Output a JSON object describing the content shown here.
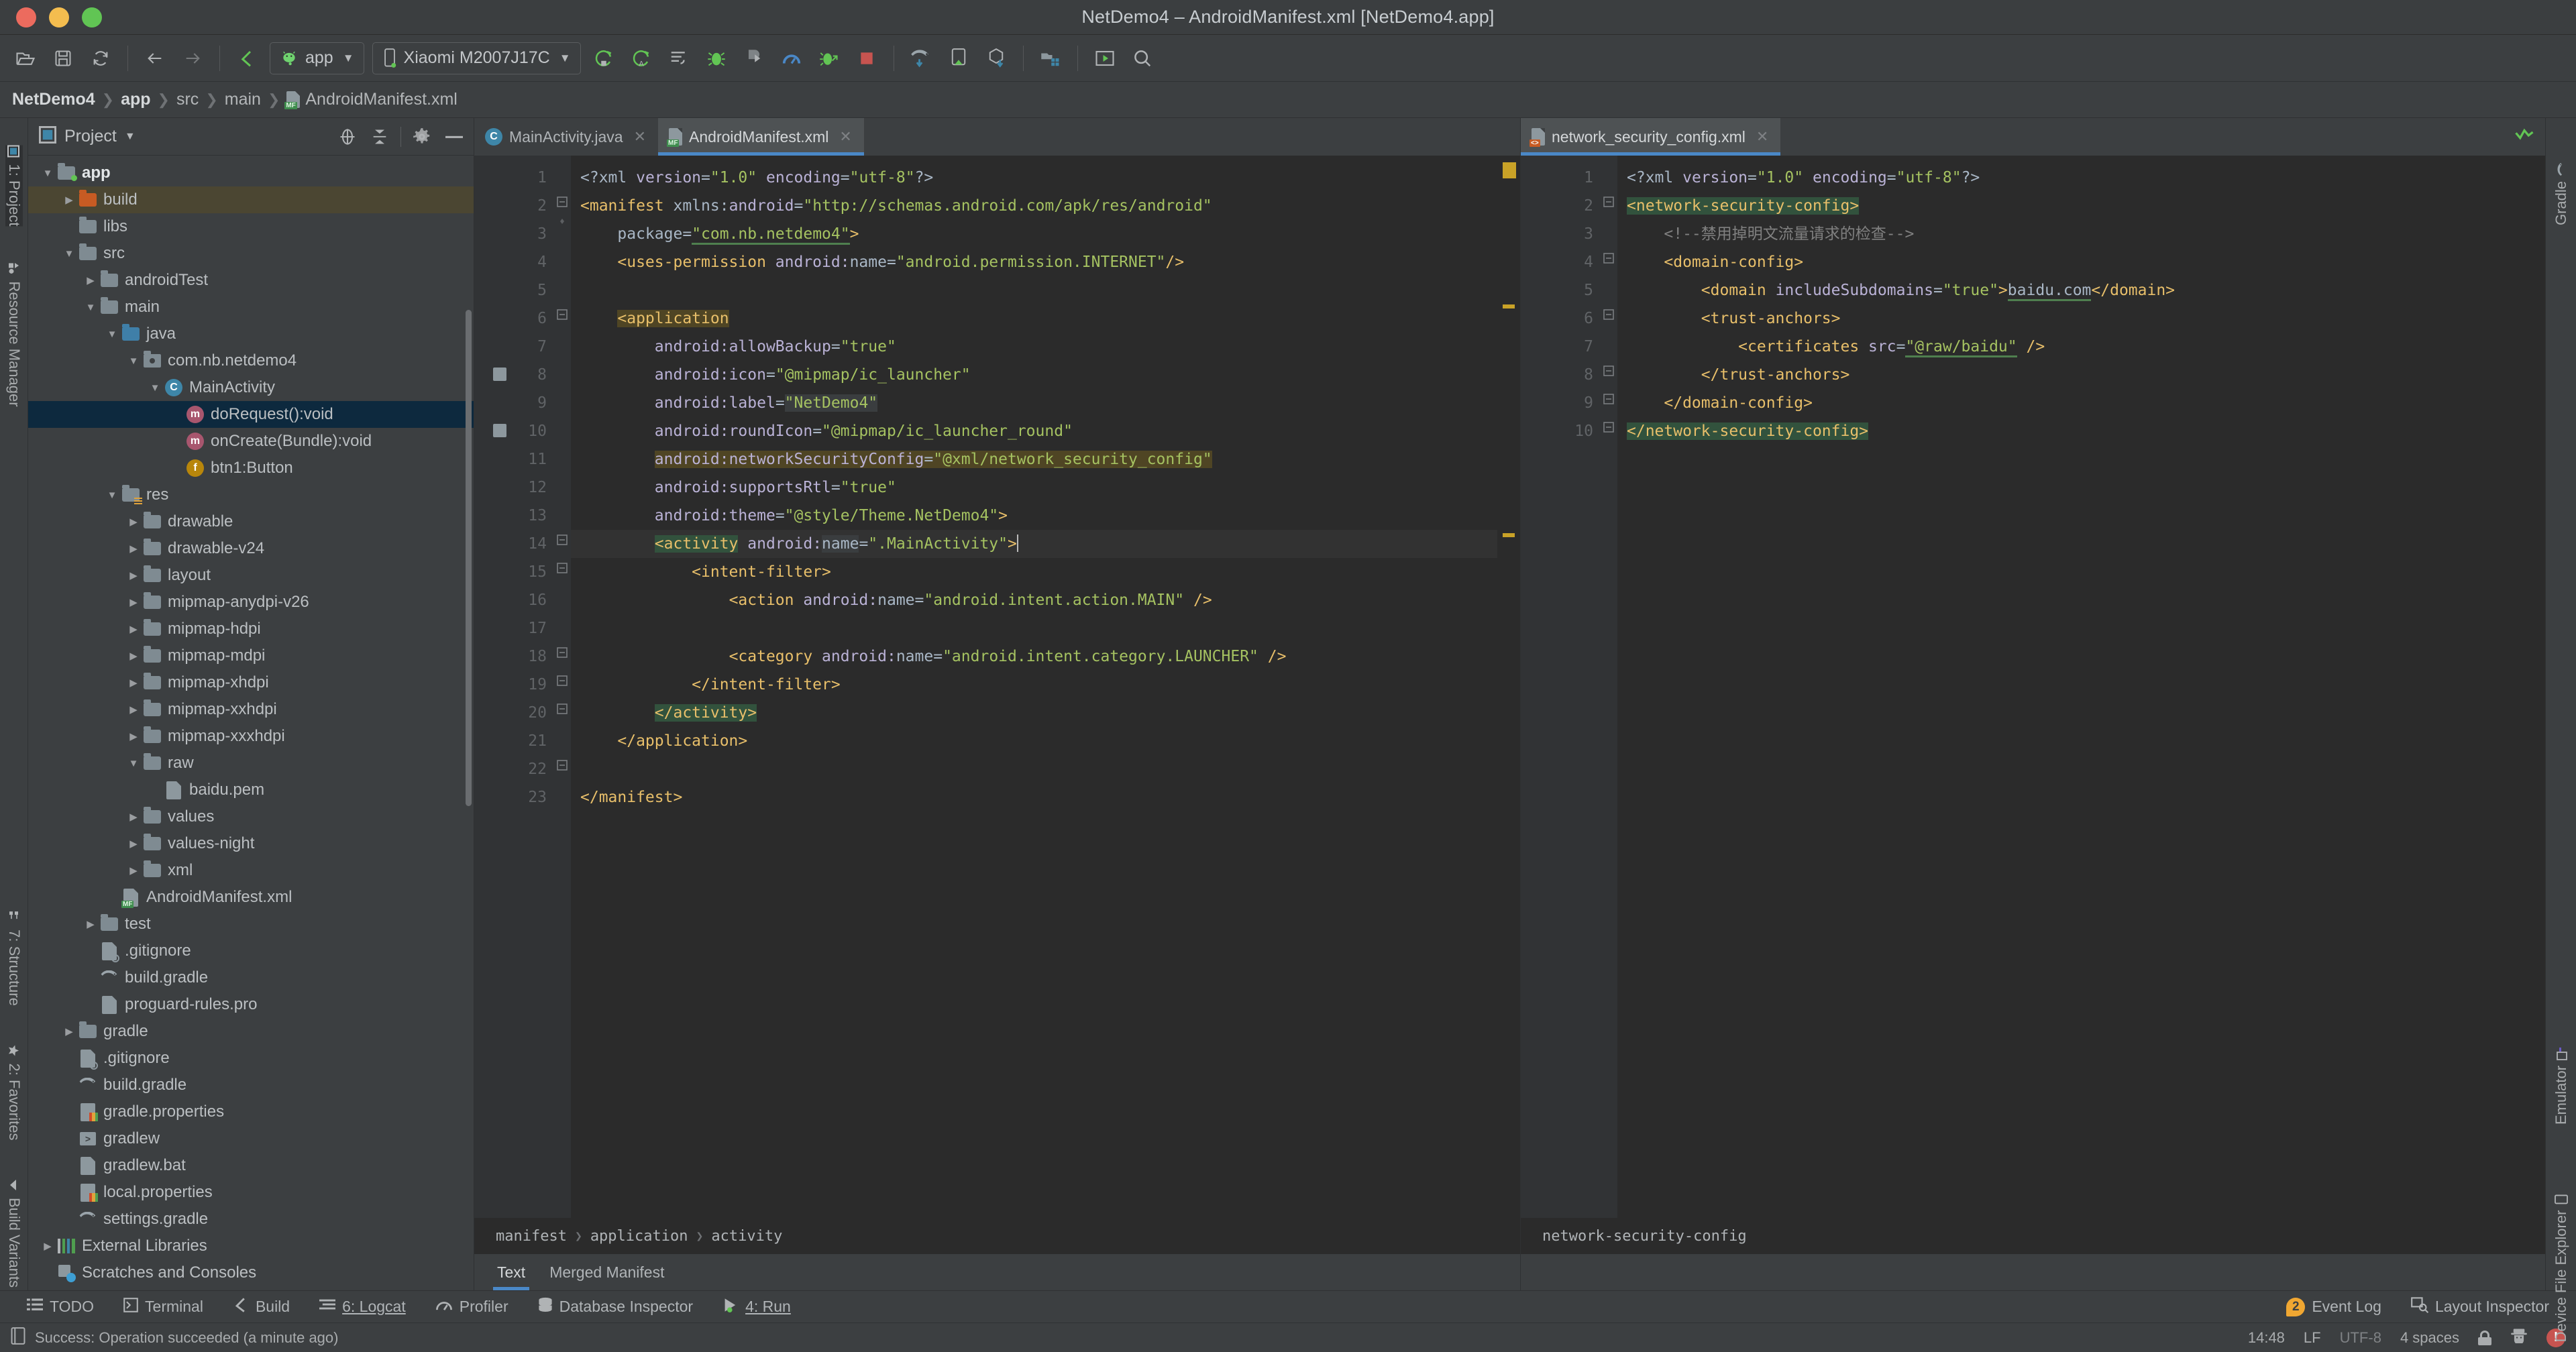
{
  "window": {
    "title": "NetDemo4 – AndroidManifest.xml [NetDemo4.app]"
  },
  "toolbar": {
    "module_combo": "app",
    "device_combo": "Xiaomi M2007J17C"
  },
  "navbar": {
    "items": [
      "NetDemo4",
      "app",
      "src",
      "main",
      "AndroidManifest.xml"
    ]
  },
  "left_strip": {
    "items": [
      "1: Project",
      "Resource Manager",
      "7: Structure",
      "2: Favorites",
      "Build Variants"
    ]
  },
  "right_strip": {
    "items": [
      "Gradle",
      "Emulator",
      "Device File Explorer"
    ]
  },
  "project_pane": {
    "title": "Project",
    "tree": [
      {
        "label": "app",
        "indent": 1,
        "arrow": "down",
        "icon": "folder-module",
        "bold": true,
        "sel": ""
      },
      {
        "label": "build",
        "indent": 2,
        "arrow": "right",
        "icon": "folder-orange",
        "bold": false,
        "sel": "build"
      },
      {
        "label": "libs",
        "indent": 2,
        "arrow": "none",
        "icon": "folder",
        "bold": false,
        "sel": ""
      },
      {
        "label": "src",
        "indent": 2,
        "arrow": "down",
        "icon": "folder",
        "bold": false,
        "sel": ""
      },
      {
        "label": "androidTest",
        "indent": 3,
        "arrow": "right",
        "icon": "folder",
        "bold": false,
        "sel": ""
      },
      {
        "label": "main",
        "indent": 3,
        "arrow": "down",
        "icon": "folder",
        "bold": false,
        "sel": ""
      },
      {
        "label": "java",
        "indent": 4,
        "arrow": "down",
        "icon": "folder-blue",
        "bold": false,
        "sel": ""
      },
      {
        "label": "com.nb.netdemo4",
        "indent": 5,
        "arrow": "down",
        "icon": "package",
        "bold": false,
        "sel": ""
      },
      {
        "label": "MainActivity",
        "indent": 6,
        "arrow": "down",
        "icon": "class",
        "bold": false,
        "sel": ""
      },
      {
        "label": "doRequest():void",
        "indent": 7,
        "arrow": "none",
        "icon": "method",
        "bold": false,
        "sel": "blue"
      },
      {
        "label": "onCreate(Bundle):void",
        "indent": 7,
        "arrow": "none",
        "icon": "method",
        "bold": false,
        "sel": ""
      },
      {
        "label": "btn1:Button",
        "indent": 7,
        "arrow": "none",
        "icon": "field",
        "bold": false,
        "sel": ""
      },
      {
        "label": "res",
        "indent": 4,
        "arrow": "down",
        "icon": "folder-res",
        "bold": false,
        "sel": ""
      },
      {
        "label": "drawable",
        "indent": 5,
        "arrow": "right",
        "icon": "folder",
        "bold": false,
        "sel": ""
      },
      {
        "label": "drawable-v24",
        "indent": 5,
        "arrow": "right",
        "icon": "folder",
        "bold": false,
        "sel": ""
      },
      {
        "label": "layout",
        "indent": 5,
        "arrow": "right",
        "icon": "folder",
        "bold": false,
        "sel": ""
      },
      {
        "label": "mipmap-anydpi-v26",
        "indent": 5,
        "arrow": "right",
        "icon": "folder",
        "bold": false,
        "sel": ""
      },
      {
        "label": "mipmap-hdpi",
        "indent": 5,
        "arrow": "right",
        "icon": "folder",
        "bold": false,
        "sel": ""
      },
      {
        "label": "mipmap-mdpi",
        "indent": 5,
        "arrow": "right",
        "icon": "folder",
        "bold": false,
        "sel": ""
      },
      {
        "label": "mipmap-xhdpi",
        "indent": 5,
        "arrow": "right",
        "icon": "folder",
        "bold": false,
        "sel": ""
      },
      {
        "label": "mipmap-xxhdpi",
        "indent": 5,
        "arrow": "right",
        "icon": "folder",
        "bold": false,
        "sel": ""
      },
      {
        "label": "mipmap-xxxhdpi",
        "indent": 5,
        "arrow": "right",
        "icon": "folder",
        "bold": false,
        "sel": ""
      },
      {
        "label": "raw",
        "indent": 5,
        "arrow": "down",
        "icon": "folder",
        "bold": false,
        "sel": ""
      },
      {
        "label": "baidu.pem",
        "indent": 6,
        "arrow": "none",
        "icon": "file-text",
        "bold": false,
        "sel": ""
      },
      {
        "label": "values",
        "indent": 5,
        "arrow": "right",
        "icon": "folder",
        "bold": false,
        "sel": ""
      },
      {
        "label": "values-night",
        "indent": 5,
        "arrow": "right",
        "icon": "folder",
        "bold": false,
        "sel": ""
      },
      {
        "label": "xml",
        "indent": 5,
        "arrow": "right",
        "icon": "folder",
        "bold": false,
        "sel": ""
      },
      {
        "label": "AndroidManifest.xml",
        "indent": 4,
        "arrow": "none",
        "icon": "file-manifest",
        "bold": false,
        "sel": ""
      },
      {
        "label": "test",
        "indent": 3,
        "arrow": "right",
        "icon": "folder",
        "bold": false,
        "sel": ""
      },
      {
        "label": ".gitignore",
        "indent": 3,
        "arrow": "none",
        "icon": "file-git",
        "bold": false,
        "sel": ""
      },
      {
        "label": "build.gradle",
        "indent": 3,
        "arrow": "none",
        "icon": "gradle",
        "bold": false,
        "sel": ""
      },
      {
        "label": "proguard-rules.pro",
        "indent": 3,
        "arrow": "none",
        "icon": "file-text",
        "bold": false,
        "sel": ""
      },
      {
        "label": "gradle",
        "indent": 2,
        "arrow": "right",
        "icon": "folder",
        "bold": false,
        "sel": ""
      },
      {
        "label": ".gitignore",
        "indent": 2,
        "arrow": "none",
        "icon": "file-git",
        "bold": false,
        "sel": ""
      },
      {
        "label": "build.gradle",
        "indent": 2,
        "arrow": "none",
        "icon": "gradle",
        "bold": false,
        "sel": ""
      },
      {
        "label": "gradle.properties",
        "indent": 2,
        "arrow": "none",
        "icon": "file-props",
        "bold": false,
        "sel": ""
      },
      {
        "label": "gradlew",
        "indent": 2,
        "arrow": "none",
        "icon": "file-shell",
        "bold": false,
        "sel": ""
      },
      {
        "label": "gradlew.bat",
        "indent": 2,
        "arrow": "none",
        "icon": "file-text",
        "bold": false,
        "sel": ""
      },
      {
        "label": "local.properties",
        "indent": 2,
        "arrow": "none",
        "icon": "file-props",
        "bold": false,
        "sel": ""
      },
      {
        "label": "settings.gradle",
        "indent": 2,
        "arrow": "none",
        "icon": "gradle",
        "bold": false,
        "sel": ""
      },
      {
        "label": "External Libraries",
        "indent": 1,
        "arrow": "right",
        "icon": "libraries",
        "bold": false,
        "sel": ""
      },
      {
        "label": "Scratches and Consoles",
        "indent": 1,
        "arrow": "none",
        "icon": "scratches",
        "bold": false,
        "sel": ""
      }
    ]
  },
  "editor_left": {
    "tabs": [
      {
        "label": "MainActivity.java",
        "icon": "java-class-icon",
        "active": false
      },
      {
        "label": "AndroidManifest.xml",
        "icon": "manifest-icon",
        "active": true
      }
    ],
    "breadcrumb": [
      "manifest",
      "application",
      "activity"
    ],
    "bottom_tabs": [
      {
        "label": "Text",
        "active": true
      },
      {
        "label": "Merged Manifest",
        "active": false
      }
    ],
    "line_numbers": [
      1,
      2,
      3,
      4,
      5,
      6,
      7,
      8,
      9,
      10,
      11,
      12,
      13,
      14,
      15,
      16,
      17,
      18,
      19,
      20,
      21,
      22,
      23
    ]
  },
  "editor_right": {
    "tabs": [
      {
        "label": "network_security_config.xml",
        "icon": "xml-icon",
        "active": true
      }
    ],
    "breadcrumb": [
      "network-security-config"
    ],
    "line_numbers": [
      1,
      2,
      3,
      4,
      5,
      6,
      7,
      8,
      9,
      10
    ]
  },
  "tool_windows": [
    {
      "label": "TODO",
      "icon": "todo-icon"
    },
    {
      "label": "Terminal",
      "icon": "terminal-icon"
    },
    {
      "label": "Build",
      "icon": "build-icon"
    },
    {
      "label": "6: Logcat",
      "icon": "logcat-icon"
    },
    {
      "label": "Profiler",
      "icon": "profiler-icon"
    },
    {
      "label": "Database Inspector",
      "icon": "database-icon"
    },
    {
      "label": "4: Run",
      "icon": "run-icon"
    }
  ],
  "tool_windows_right": [
    {
      "label": "Event Log",
      "icon": "event-log-icon",
      "badge": "2"
    },
    {
      "label": "Layout Inspector",
      "icon": "layout-inspector-icon",
      "badge": ""
    }
  ],
  "status": {
    "message": "Success: Operation succeeded (a minute ago)",
    "time": "14:48",
    "line_sep": "LF",
    "encoding": "UTF-8",
    "indent": "4 spaces"
  },
  "colors": {
    "accent": "#4a88c7",
    "tag": "#e8bf6a",
    "attr": "#bab2d6",
    "value": "#a5c261",
    "comment": "#808080",
    "highlight_yellow": "#4f4524",
    "highlight_green": "#32523d",
    "selection_blue": "#0d293e",
    "selection_build": "#4b4632"
  }
}
